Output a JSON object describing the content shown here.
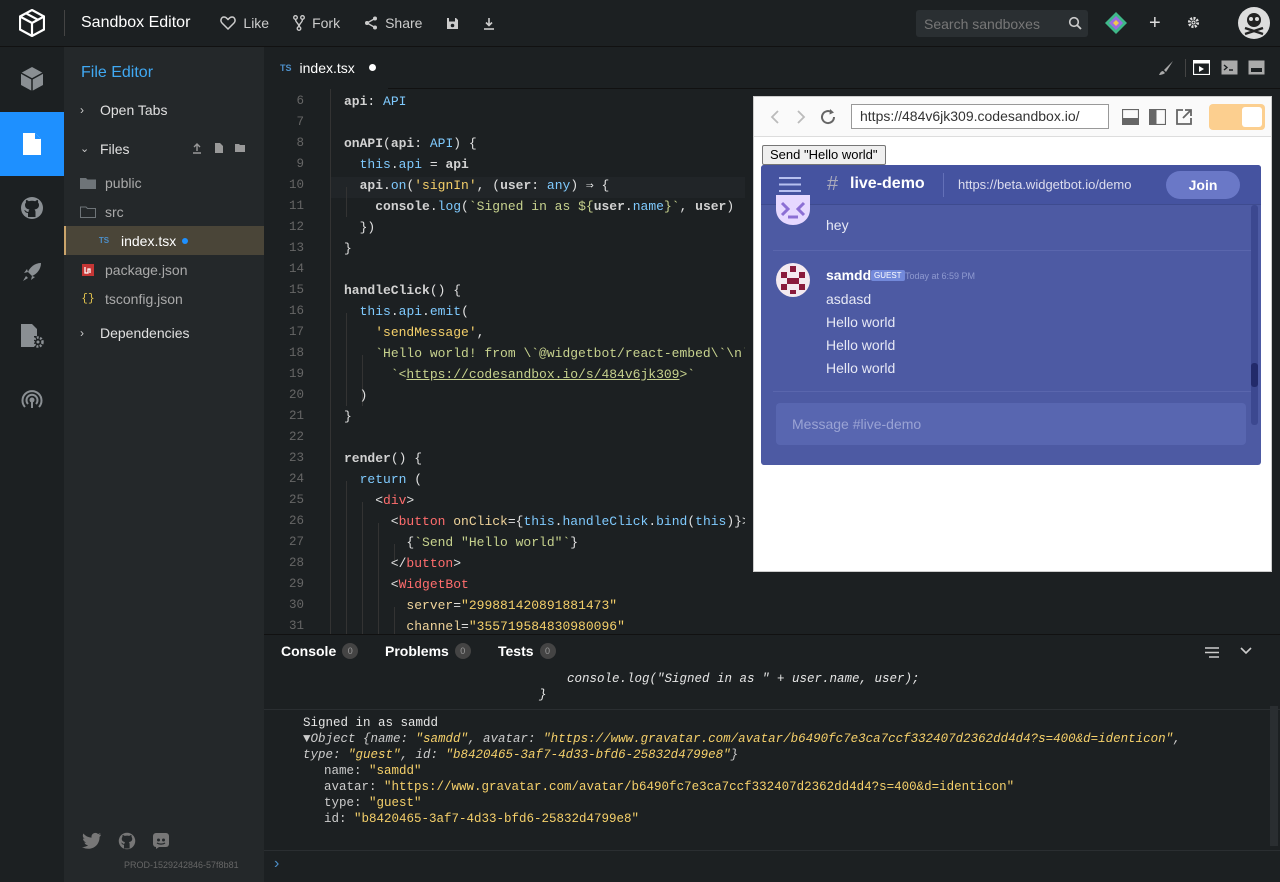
{
  "header": {
    "title": "Sandbox Editor",
    "like_label": "Like",
    "fork_label": "Fork",
    "share_label": "Share",
    "search_placeholder": "Search sandboxes"
  },
  "sidebar": {
    "title": "File Editor",
    "open_tabs": "Open Tabs",
    "files": "Files",
    "items": [
      {
        "label": "public",
        "type": "folder"
      },
      {
        "label": "src",
        "type": "folder-open"
      },
      {
        "label": "index.tsx",
        "type": "ts-file"
      },
      {
        "label": "package.json",
        "type": "npm-file"
      },
      {
        "label": "tsconfig.json",
        "type": "json-file"
      }
    ],
    "dependencies": "Dependencies",
    "version": "PROD-1529242846-57f8b81"
  },
  "editor": {
    "tab": {
      "prefix": "TS",
      "name": "index.tsx"
    },
    "line_numbers": [
      "6",
      "7",
      "8",
      "9",
      "10",
      "11",
      "12",
      "13",
      "14",
      "15",
      "16",
      "17",
      "18",
      "19",
      "20",
      "21",
      "22",
      "23",
      "24",
      "25",
      "26",
      "27",
      "28",
      "29",
      "30",
      "31"
    ]
  },
  "preview": {
    "url": "https://484v6jk309.codesandbox.io/",
    "send_button": "Send \"Hello world\"",
    "discord": {
      "channel": "live-demo",
      "link": "https://beta.widgetbot.io/demo",
      "join": "Join",
      "first_msg": "hey",
      "user": "samdd",
      "badge": "GUEST",
      "time": "Today at 6:59 PM",
      "messages": [
        "asdasd",
        "Hello world",
        "Hello world",
        "Hello world"
      ],
      "composer_placeholder": "Message #live-demo"
    }
  },
  "panel": {
    "tabs": [
      {
        "label": "Console",
        "count": "0"
      },
      {
        "label": "Problems",
        "count": "0"
      },
      {
        "label": "Tests",
        "count": "0"
      }
    ]
  },
  "console": {
    "fn_line": "console.log(\"Signed in as \" + user.name, user);",
    "brace": "}",
    "signed_in": "Signed in as samdd",
    "obj_line1_pre": "▼Object {",
    "obj_line1_name_key": "name: ",
    "obj_line1_name_val": "\"samdd\"",
    "obj_line1_avatar_key": ", avatar: ",
    "obj_line1_avatar_val": "\"https://www.gravatar.com/avatar/b6490fc7e3ca7ccf332407d2362dd4d4?s=400&d=identicon\"",
    "obj_line1_end": ",",
    "obj_line2_type_key": "type: ",
    "obj_line2_type_val": "\"guest\"",
    "obj_line2_id_key": ", id: ",
    "obj_line2_id_val": "\"b8420465-3af7-4d33-bfd6-25832d4799e8\"",
    "obj_line2_end": "}",
    "props": [
      {
        "key": "name: ",
        "val": "\"samdd\""
      },
      {
        "key": "avatar: ",
        "val": "\"https://www.gravatar.com/avatar/b6490fc7e3ca7ccf332407d2362dd4d4?s=400&d=identicon\""
      },
      {
        "key": "type: ",
        "val": "\"guest\""
      },
      {
        "key": "id: ",
        "val": "\"b8420465-3af7-4d33-bfd6-25832d4799e8\""
      }
    ],
    "prompt": "›"
  },
  "colors": {
    "accent": "#1e90ff",
    "sidebar_title": "#40a9f3",
    "discord_bg": "#4d5aa3",
    "toggle": "#fccf8f"
  }
}
